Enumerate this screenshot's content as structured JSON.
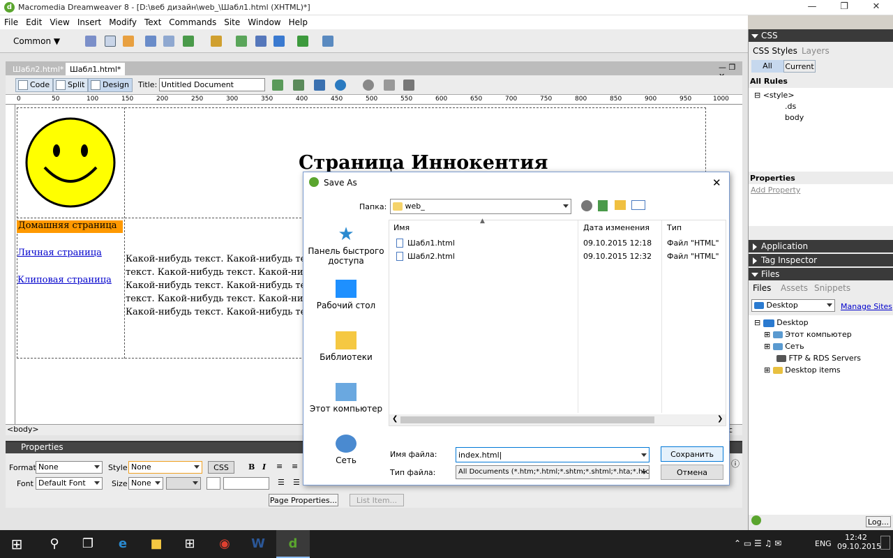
{
  "window": {
    "title": "Macromedia Dreamweaver 8 - [D:\\веб дизайн\\web_\\Шабл1.html (XHTML)*]"
  },
  "menu": [
    "File",
    "Edit",
    "View",
    "Insert",
    "Modify",
    "Text",
    "Commands",
    "Site",
    "Window",
    "Help"
  ],
  "insert_bar": {
    "category": "Common"
  },
  "doc_tabs": [
    "Шабл2.html*",
    "Шабл1.html*"
  ],
  "doc_toolbar": {
    "code": "Code",
    "split": "Split",
    "design": "Design",
    "title_label": "Title:",
    "title_value": "Untitled Document"
  },
  "ruler": [
    "0",
    "50",
    "100",
    "150",
    "200",
    "250",
    "300",
    "350",
    "400",
    "450",
    "500",
    "550",
    "600",
    "650",
    "700",
    "750",
    "800",
    "850",
    "900",
    "950",
    "1000"
  ],
  "page": {
    "heading": "Страница Иннокентия",
    "nav": [
      "Домашняя страница",
      "Личная страница",
      "Клиповая страница"
    ],
    "body_lines": [
      "Какой-нибудь текст. Какой-нибудь те",
      "текст. Какой-нибудь текст. Какой-ни",
      "Какой-нибудь текст. Какой-нибудь те",
      "текст. Какой-нибудь текст. Какой-ни",
      "Какой-нибудь текст. Какой-нибудь те"
    ]
  },
  "status_tag": "<body>",
  "status_tail": "c",
  "properties": {
    "title": "Properties",
    "format_label": "Format",
    "format_value": "None",
    "style_label": "Style",
    "style_value": "None",
    "css_btn": "CSS",
    "font_label": "Font",
    "font_value": "Default Font",
    "size_label": "Size",
    "size_value": "None",
    "page_props": "Page Properties...",
    "list_item": "List Item..."
  },
  "css_panel": {
    "title": "CSS",
    "tabs": [
      "CSS Styles",
      "Layers"
    ],
    "modes": [
      "All",
      "Current"
    ],
    "all_rules": "All Rules",
    "rules": [
      "<style>",
      ".ds",
      "body"
    ],
    "props_title": "Properties",
    "add_property": "Add Property"
  },
  "collapsed_panels": [
    "Application",
    "Tag Inspector"
  ],
  "files_panel": {
    "title": "Files",
    "tabs": [
      "Files",
      "Assets",
      "Snippets"
    ],
    "location": "Desktop",
    "manage": "Manage Sites",
    "tree": [
      "Desktop",
      "Этот компьютер",
      "Сеть",
      "FTP & RDS Servers",
      "Desktop items"
    ],
    "log_btn": "Log..."
  },
  "dialog": {
    "title": "Save As",
    "folder_label": "Папка:",
    "folder_value": "web_",
    "places": [
      "Панель быстрого доступа",
      "Рабочий стол",
      "Библиотеки",
      "Этот компьютер",
      "Сеть"
    ],
    "columns": [
      "Имя",
      "Дата изменения",
      "Тип"
    ],
    "files": [
      {
        "name": "Шабл1.html",
        "date": "09.10.2015 12:18",
        "type": "Файл \"HTML\""
      },
      {
        "name": "Шабл2.html",
        "date": "09.10.2015 12:32",
        "type": "Файл \"HTML\""
      }
    ],
    "filename_label": "Имя файла:",
    "filename_value": "index.html",
    "filetype_label": "Тип файла:",
    "filetype_value": "All Documents (*.htm;*.html;*.shtm;*.shtml;*.hta;*.htc;*.",
    "save": "Сохранить",
    "cancel": "Отмена"
  },
  "taskbar": {
    "lang": "ENG",
    "time": "12:42",
    "date": "09.10.2015"
  },
  "colors": {
    "nav_active_bg": "#ff9900",
    "link": "#0000cc",
    "smiley": "#ffff00",
    "taskbar": "#1e1e1e",
    "accent": "#0078d7"
  }
}
